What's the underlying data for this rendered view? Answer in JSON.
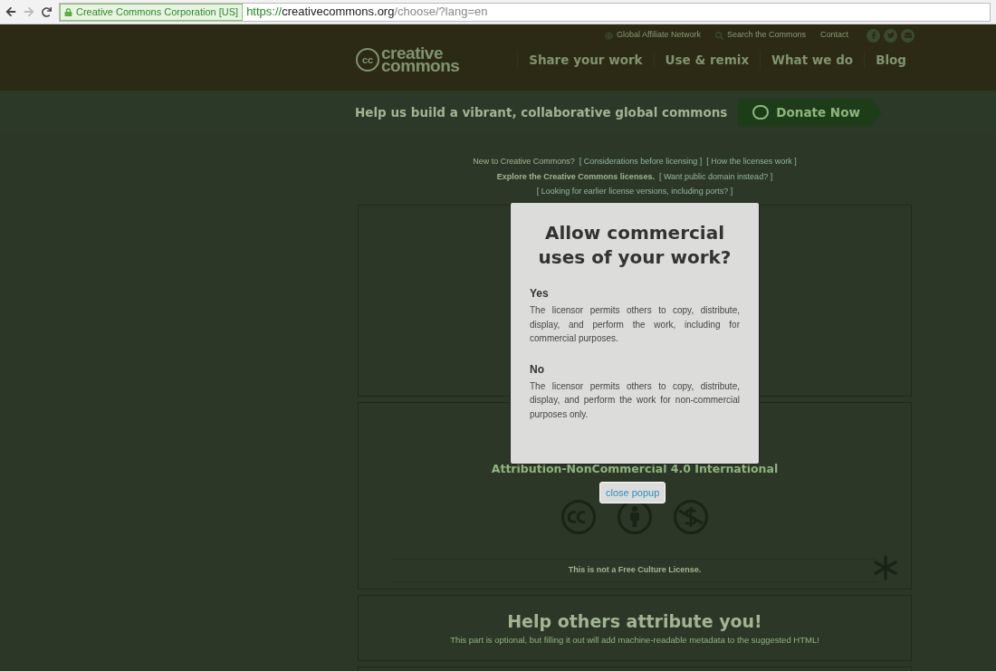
{
  "browser": {
    "site_identity": "Creative Commons Corporation [US]",
    "url_scheme": "https://",
    "url_host": "creativecommons.org",
    "url_path": "/choose/?lang=en"
  },
  "header": {
    "logo_mark": "cc",
    "logo_lines": [
      "creative",
      "commons"
    ],
    "utility_links": [
      {
        "kind": "globe",
        "label": "Global Affiliate Network"
      },
      {
        "kind": "search",
        "label": "Search the Commons"
      },
      {
        "kind": "plain",
        "label": "Contact"
      }
    ],
    "nav": [
      "Share your work",
      "Use & remix",
      "What we do",
      "Blog"
    ]
  },
  "donate_bar": {
    "text": "Help us build a vibrant, collaborative global commons",
    "button": "Donate Now"
  },
  "intro_lines": [
    [
      {
        "kind": "text",
        "label": "New to Creative Commons?"
      },
      {
        "kind": "link",
        "label": "[ Considerations before licensing ]"
      },
      {
        "kind": "link",
        "label": "[ How the licenses work ]"
      }
    ],
    [
      {
        "kind": "bold",
        "label": "Explore the Creative Commons licenses."
      },
      {
        "kind": "link",
        "label": "[ Want public domain instead? ]"
      }
    ],
    [
      {
        "kind": "link",
        "label": "[ Looking for earlier license versions, including ports? ]"
      }
    ]
  ],
  "license_panel": {
    "license_name": "Attribution-NonCommercial 4.0 International",
    "free_culture_note": "This is not a Free Culture License."
  },
  "attribution_panel": {
    "title": "Help others attribute you!",
    "subtitle": "This part is optional, but filling it out will add machine-readable metadata to the suggested HTML!"
  },
  "modal": {
    "title": "Allow commercial uses of your work?",
    "options": [
      {
        "heading": "Yes",
        "text": "The licensor permits others to copy, distribute, display, and perform the work, including for commercial purposes."
      },
      {
        "heading": "No",
        "text": "The licensor permits others to copy, distribute, display, and perform the work for non-commercial purposes only."
      }
    ],
    "close_button": "close popup"
  }
}
